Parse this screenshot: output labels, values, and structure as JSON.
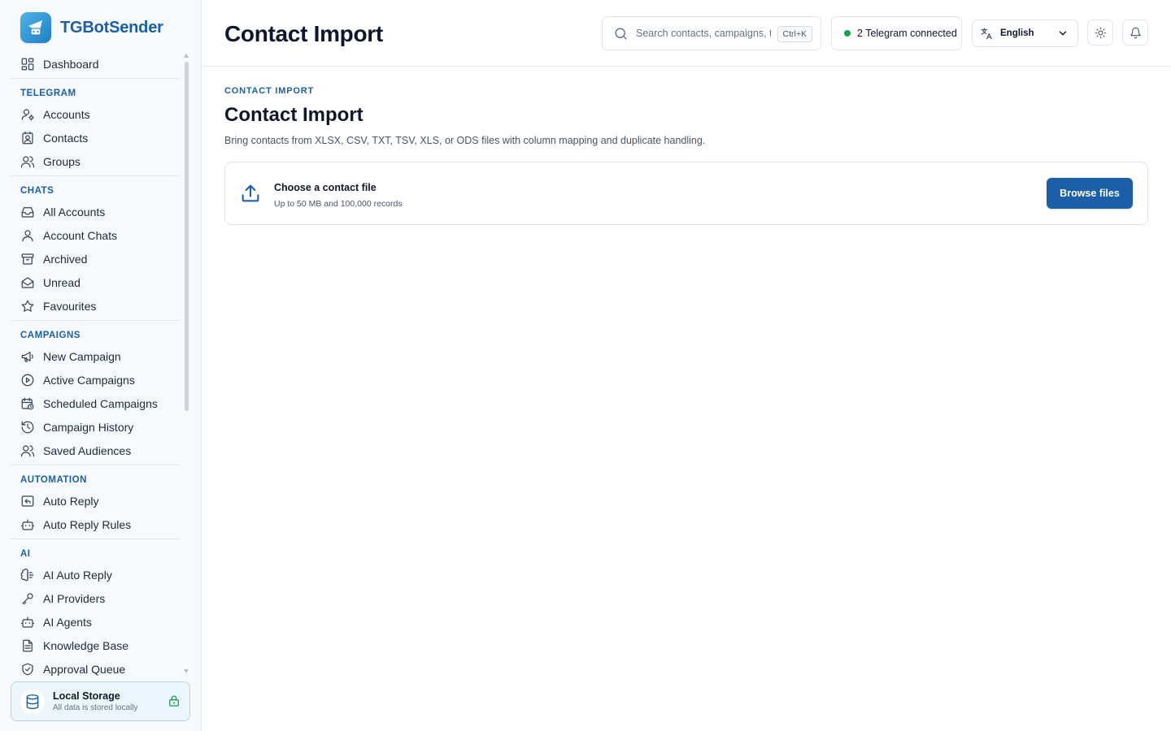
{
  "app": {
    "name": "TGBotSender"
  },
  "colors": {
    "accent": "#1b5fa8",
    "status_online": "#16a34a",
    "sidebar_bg": "#f7fafd"
  },
  "sidebar": {
    "dashboard": {
      "label": "Dashboard",
      "icon": "dashboard-icon"
    },
    "sections": [
      {
        "title": "TELEGRAM",
        "items": [
          {
            "label": "Accounts",
            "icon": "accounts-icon"
          },
          {
            "label": "Contacts",
            "icon": "contacts-icon"
          },
          {
            "label": "Groups",
            "icon": "groups-icon"
          }
        ]
      },
      {
        "title": "CHATS",
        "items": [
          {
            "label": "All Accounts",
            "icon": "inbox-icon"
          },
          {
            "label": "Account Chats",
            "icon": "user-icon"
          },
          {
            "label": "Archived",
            "icon": "archive-icon"
          },
          {
            "label": "Unread",
            "icon": "mail-open-icon"
          },
          {
            "label": "Favourites",
            "icon": "star-icon"
          }
        ]
      },
      {
        "title": "CAMPAIGNS",
        "items": [
          {
            "label": "New Campaign",
            "icon": "megaphone-icon"
          },
          {
            "label": "Active Campaigns",
            "icon": "play-circle-icon"
          },
          {
            "label": "Scheduled Campaigns",
            "icon": "calendar-clock-icon"
          },
          {
            "label": "Campaign History",
            "icon": "history-icon"
          },
          {
            "label": "Saved Audiences",
            "icon": "users-icon"
          }
        ]
      },
      {
        "title": "AUTOMATION",
        "items": [
          {
            "label": "Auto Reply",
            "icon": "reply-icon"
          },
          {
            "label": "Auto Reply Rules",
            "icon": "bot-icon"
          }
        ]
      },
      {
        "title": "AI",
        "items": [
          {
            "label": "AI Auto Reply",
            "icon": "brain-icon"
          },
          {
            "label": "AI Providers",
            "icon": "key-icon"
          },
          {
            "label": "AI Agents",
            "icon": "bot-icon"
          },
          {
            "label": "Knowledge Base",
            "icon": "document-icon"
          },
          {
            "label": "Approval Queue",
            "icon": "shield-check-icon"
          }
        ]
      }
    ],
    "storage": {
      "title": "Local Storage",
      "subtitle": "All data is stored locally",
      "icon": "database-icon",
      "lock_icon": "lock-icon"
    }
  },
  "header": {
    "title": "Contact Import",
    "search": {
      "placeholder": "Search contacts, campaigns, t...",
      "shortcut": "Ctrl+K"
    },
    "connection": {
      "text": "2 Telegram connected",
      "status": "online"
    },
    "language": {
      "selected": "English"
    }
  },
  "main": {
    "eyebrow": "CONTACT IMPORT",
    "title": "Contact Import",
    "description": "Bring contacts from XLSX, CSV, TXT, TSV, XLS, or ODS files with column mapping and duplicate handling.",
    "upload": {
      "title": "Choose a contact file",
      "subtitle": "Up to 50 MB and 100,000 records",
      "button": "Browse files"
    }
  }
}
